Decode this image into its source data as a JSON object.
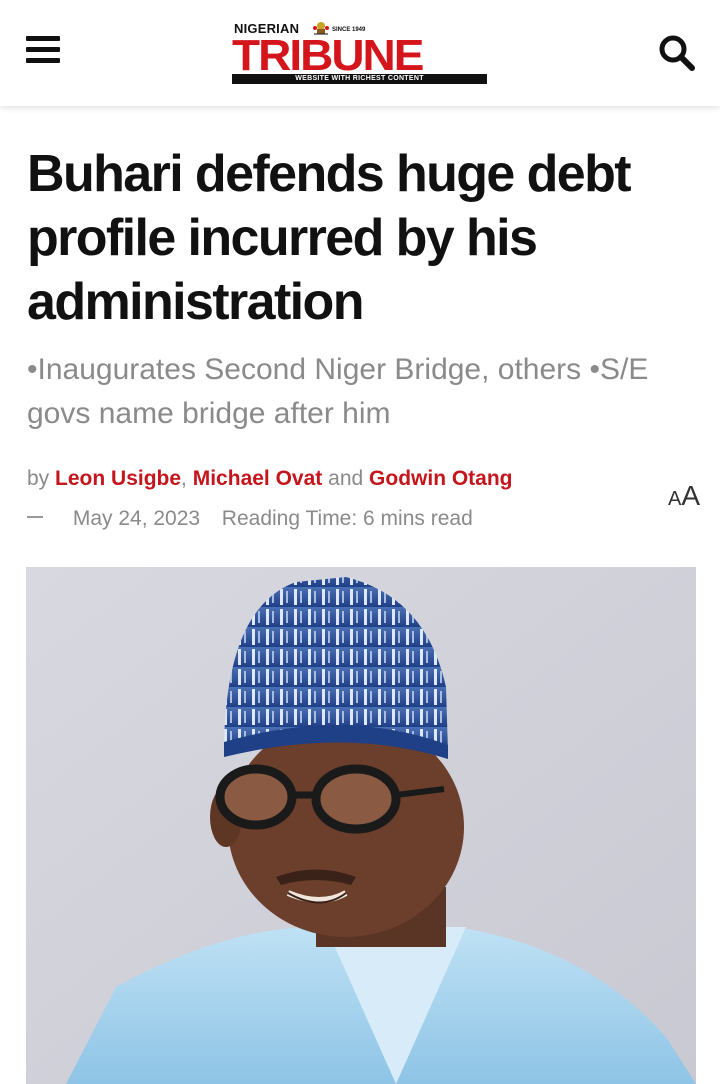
{
  "header": {
    "logo": {
      "top_text": "NIGERIAN",
      "since": "SINCE 1949",
      "main_text": "TRIBUNE",
      "tagline": "WEBSITE WITH RICHEST CONTENT"
    },
    "menu_icon": "hamburger-menu-icon",
    "search_icon": "search-icon"
  },
  "article": {
    "title": "Buhari defends huge debt profile incurred by his administration",
    "subtitle": "•Inaugurates Second Niger Bridge, others •S/E govs name bridge after him",
    "byline": {
      "by": "by",
      "authors": [
        "Leon Usigbe",
        "Michael Ovat",
        "Godwin Otang"
      ],
      "separator": ",",
      "and": "and"
    },
    "date": "May 24, 2023",
    "reading_time": "Reading Time: 6 mins read",
    "font_size_toggle": {
      "small": "A",
      "large": "A"
    }
  },
  "colors": {
    "brand_red": "#d4161c",
    "author_red": "#c4161c",
    "muted_text": "#8a8a8a"
  }
}
